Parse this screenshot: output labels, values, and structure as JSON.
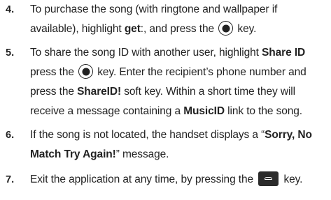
{
  "steps": [
    {
      "number": "4.",
      "line1": {
        "a": "To purchase the song (with ringtone and wallpaper if"
      },
      "line2": {
        "a": "available), highlight ",
        "b": "get",
        "c": ":, and press the ",
        "d": " key."
      }
    },
    {
      "number": "5.",
      "line1": {
        "a": "To share the song ID with another user, highlight ",
        "b": "Share ID"
      },
      "line2": {
        "a": "press the ",
        "b": " key. Enter the recipient’s phone number and"
      },
      "line3": {
        "a": "press the ",
        "b": "ShareID!",
        "c": " soft key. Within a short time they will"
      },
      "line4": {
        "a": "receive a message containing a ",
        "b": "MusicID",
        "c": " link to the song."
      }
    },
    {
      "number": "6.",
      "line1": {
        "a": "If the song is not located, the handset displays a “",
        "b": "Sorry, No"
      },
      "line2": {
        "a": "Match Try Again!",
        "b": "” message."
      }
    },
    {
      "number": "7.",
      "line1": {
        "a": "Exit the application at any time, by pressing the ",
        "b": " key."
      }
    }
  ],
  "icons": {
    "ok_key": "ok-key-icon",
    "end_key": "end-key-icon"
  }
}
